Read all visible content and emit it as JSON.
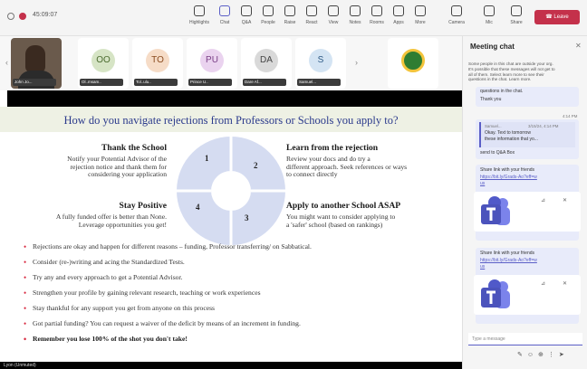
{
  "toolbar": {
    "timer": "45:09:07",
    "buttons": [
      {
        "label": "Highlights",
        "icon": "highlight-icon"
      },
      {
        "label": "Chat",
        "icon": "chat-icon"
      },
      {
        "label": "Q&A",
        "icon": "qa-icon"
      },
      {
        "label": "People",
        "icon": "people-icon"
      },
      {
        "label": "Raise",
        "icon": "raise-hand-icon"
      },
      {
        "label": "React",
        "icon": "react-icon"
      },
      {
        "label": "View",
        "icon": "view-icon"
      },
      {
        "label": "Notes",
        "icon": "notes-icon"
      },
      {
        "label": "Rooms",
        "icon": "rooms-icon"
      },
      {
        "label": "Apps",
        "icon": "apps-icon"
      },
      {
        "label": "More",
        "icon": "more-icon"
      },
      {
        "label": "Camera",
        "icon": "camera-icon"
      },
      {
        "label": "Mic",
        "icon": "mic-icon"
      },
      {
        "label": "Share",
        "icon": "share-icon"
      }
    ],
    "leave_label": "Leave"
  },
  "participants": [
    {
      "kind": "video",
      "name": "John Jo..."
    },
    {
      "initials": "OO",
      "name": "Ol..msam..",
      "color": "#d6e4c5",
      "text_color": "#4b6b2f"
    },
    {
      "initials": "TO",
      "name": "Tol..ulu..",
      "color": "#f6dcc7",
      "text_color": "#8a4b1f"
    },
    {
      "initials": "PU",
      "name": "Prince U..",
      "color": "#ead3ef",
      "text_color": "#7a3f86"
    },
    {
      "initials": "DA",
      "name": "Dare Af...",
      "color": "#d9d9d9",
      "text_color": "#444444"
    },
    {
      "initials": "S",
      "name": "Samuel...",
      "color": "#d4e4f3",
      "text_color": "#2f5b86"
    },
    {
      "kind": "logo",
      "name": ""
    }
  ],
  "slide": {
    "title": "How do you navigate rejections from Professors or Schools you apply to?",
    "blocks": {
      "thank": {
        "heading": "Thank the School",
        "text": [
          "Notify your Potential Advisor of the",
          "rejection notice and thank them for",
          "considering your application"
        ]
      },
      "positive": {
        "heading": "Stay Positive",
        "text": [
          "A fully funded offer is better than None.",
          "Leverage opportunities you get!"
        ]
      },
      "learn": {
        "heading": "Learn from the rejection",
        "text": [
          "Review your docs and do try a",
          "different approach. Seek references or ways",
          "to connect directly"
        ]
      },
      "apply": {
        "heading": "Apply to another School ASAP",
        "text": [
          "You might want to consider applying to",
          "a 'safer' school (based on rankings)"
        ]
      }
    },
    "cycle_numbers": [
      "1",
      "2",
      "3",
      "4"
    ],
    "bullets": [
      "Rejections are okay and happen for different reasons – funding, Professor transferring/ on Sabbatical.",
      "Consider (re-)writing and acing the Standardized Tests.",
      "Try any and every approach to get a Potential Advisor.",
      "Strengthen your profile by gaining relevant research, teaching or work experiences",
      "Stay thankful for any support you get from anyone on this process",
      "Got partial funding? You can request a waiver of the deficit by means of an increment in funding.",
      "Remember you lose 100% of the shot you don't take!"
    ],
    "presenter_label": "Lyon (Unmuted)"
  },
  "chat": {
    "title": "Meeting chat",
    "notice": [
      "Some people in this chat are outside your org.",
      "It's possible that these messages will not get to",
      "all of them. Select learn more to see their",
      "questions in the chat. Learn more."
    ],
    "messages": [
      {
        "lines": [
          "questions in the chat."
        ],
        "time": ""
      },
      {
        "lines": [
          "Thank you"
        ],
        "time": "4:14 PM"
      },
      {
        "sender": "Samuel...",
        "time": "3/15/24, 4:14 PM",
        "quote": [
          "Okay. Text to tomorrow",
          "these information that yo..."
        ],
        "lines": [
          "send to Q&A Box"
        ]
      },
      {
        "lines": [
          "Share link with your friends"
        ],
        "link": [
          "https://bit.ly/Grads-Ao?eff=w",
          "us"
        ]
      },
      {
        "lines": [
          "Share link with your friends"
        ],
        "link": [
          "https://bit.ly/Grads-Ao?eff=w",
          "us"
        ]
      }
    ],
    "input_placeholder": "Type a message"
  }
}
